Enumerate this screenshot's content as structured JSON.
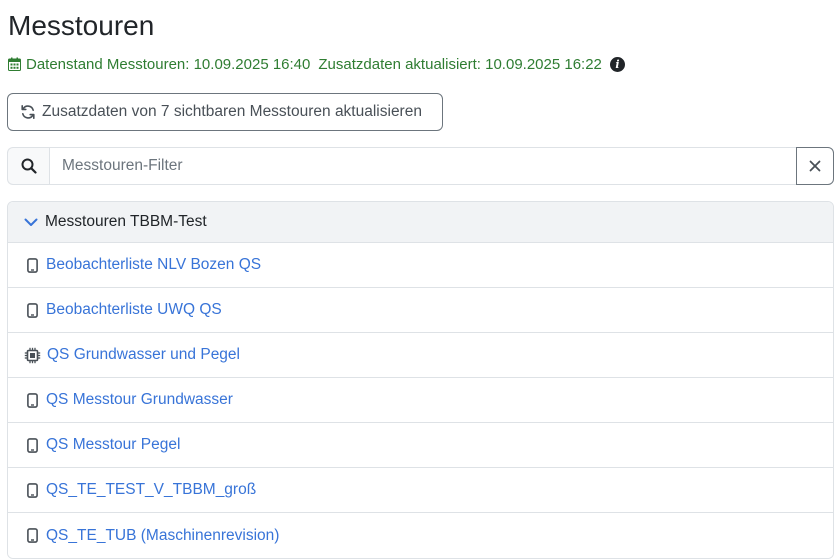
{
  "page": {
    "title": "Messtouren"
  },
  "status": {
    "data_state": "Datenstand Messtouren: 10.09.2025 16:40",
    "extra_updated": "Zusatzdaten aktualisiert: 10.09.2025 16:22",
    "calendar_icon": "calendar-icon",
    "info_icon": "info-icon",
    "color": "#2f7d32"
  },
  "toolbar": {
    "refresh_label": "Zusatzdaten von 7 sichtbaren Messtouren aktualisieren",
    "refresh_icon": "refresh-icon"
  },
  "search": {
    "placeholder": "Messtouren-Filter",
    "value": "",
    "search_icon": "search-icon",
    "clear_icon": "close-icon"
  },
  "group": {
    "label": "Messtouren TBBM-Test",
    "expanded": true,
    "items": [
      {
        "label": "Beobachterliste NLV Bozen QS",
        "icon": "mobile-icon"
      },
      {
        "label": "Beobachterliste UWQ QS",
        "icon": "mobile-icon"
      },
      {
        "label": "QS Grundwasser und Pegel",
        "icon": "chip-icon"
      },
      {
        "label": "QS Messtour Grundwasser",
        "icon": "mobile-icon"
      },
      {
        "label": "QS Messtour Pegel",
        "icon": "mobile-icon"
      },
      {
        "label": "QS_TE_TEST_V_TBBM_groß",
        "icon": "mobile-icon"
      },
      {
        "label": "QS_TE_TUB (Maschinenrevision)",
        "icon": "mobile-icon"
      }
    ]
  },
  "colors": {
    "link": "#3874d8",
    "accent": "#3874d8"
  }
}
